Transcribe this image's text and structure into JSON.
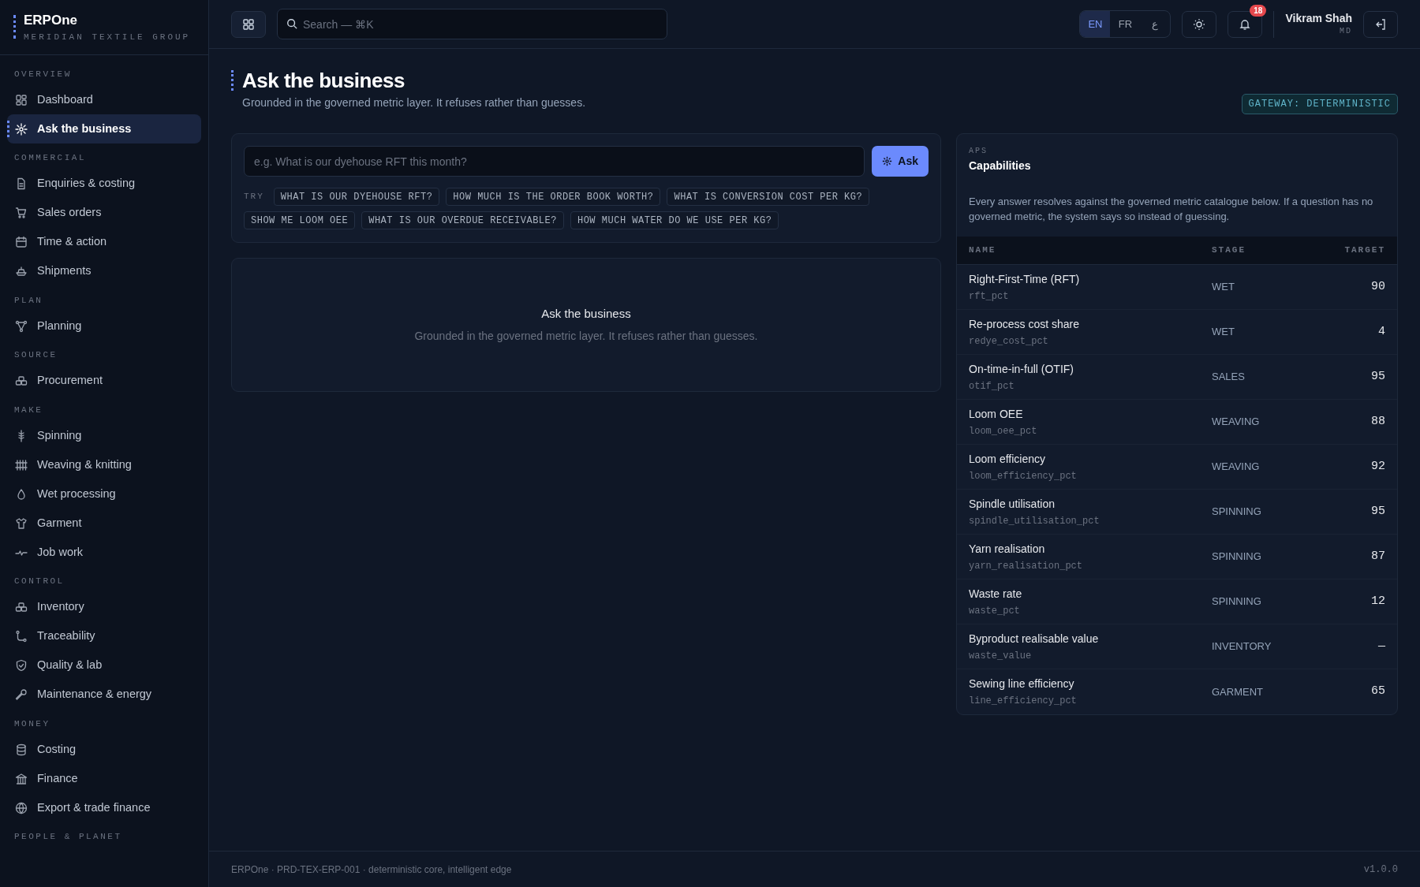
{
  "brand": {
    "name": "ERPOne",
    "subtitle": "MERIDIAN TEXTILE GROUP"
  },
  "sidebar": {
    "sections": [
      {
        "heading": "OVERVIEW",
        "items": [
          {
            "label": "Dashboard",
            "selected": false
          },
          {
            "label": "Ask the business",
            "selected": true
          }
        ]
      },
      {
        "heading": "COMMERCIAL",
        "items": [
          {
            "label": "Enquiries & costing",
            "selected": false
          },
          {
            "label": "Sales orders",
            "selected": false
          },
          {
            "label": "Time & action",
            "selected": false
          },
          {
            "label": "Shipments",
            "selected": false
          }
        ]
      },
      {
        "heading": "PLAN",
        "items": [
          {
            "label": "Planning",
            "selected": false
          }
        ]
      },
      {
        "heading": "SOURCE",
        "items": [
          {
            "label": "Procurement",
            "selected": false
          }
        ]
      },
      {
        "heading": "MAKE",
        "items": [
          {
            "label": "Spinning",
            "selected": false
          },
          {
            "label": "Weaving & knitting",
            "selected": false
          },
          {
            "label": "Wet processing",
            "selected": false
          },
          {
            "label": "Garment",
            "selected": false
          },
          {
            "label": "Job work",
            "selected": false
          }
        ]
      },
      {
        "heading": "CONTROL",
        "items": [
          {
            "label": "Inventory",
            "selected": false
          },
          {
            "label": "Traceability",
            "selected": false
          },
          {
            "label": "Quality & lab",
            "selected": false
          },
          {
            "label": "Maintenance & energy",
            "selected": false
          }
        ]
      },
      {
        "heading": "MONEY",
        "items": [
          {
            "label": "Costing",
            "selected": false
          },
          {
            "label": "Finance",
            "selected": false
          },
          {
            "label": "Export & trade finance",
            "selected": false
          }
        ]
      },
      {
        "heading": "PEOPLE & PLANET"
      }
    ]
  },
  "header": {
    "search": {
      "placeholder": "Search — ⌘K"
    },
    "languages": [
      {
        "label": "EN",
        "selected": true
      },
      {
        "label": "FR",
        "selected": false
      },
      {
        "label": "ع",
        "selected": false
      }
    ],
    "notifications": "18",
    "user": {
      "name": "Vikram Shah",
      "role": "MD"
    }
  },
  "page": {
    "title": "Ask the business",
    "subtitle": "Grounded in the governed metric layer. It refuses rather than guesses.",
    "badge": "GATEWAY: DETERMINISTIC"
  },
  "ask": {
    "placeholder": "e.g. What is our dyehouse RFT this month?",
    "button": "Ask",
    "try_label": "TRY",
    "suggestions": [
      "WHAT IS OUR DYEHOUSE RFT?",
      "HOW MUCH IS THE ORDER BOOK WORTH?",
      "WHAT IS CONVERSION COST PER KG?",
      "SHOW ME LOOM OEE",
      "WHAT IS OUR OVERDUE RECEIVABLE?",
      "HOW MUCH WATER DO WE USE PER KG?"
    ]
  },
  "empty_state": {
    "title": "Ask the business",
    "text": "Grounded in the governed metric layer. It refuses rather than guesses."
  },
  "capabilities": {
    "eyebrow": "APS",
    "title": "Capabilities",
    "description": "Every answer resolves against the governed metric catalogue below. If a question has no governed metric, the system says so instead of guessing.",
    "columns": [
      "NAME",
      "STAGE",
      "TARGET"
    ],
    "rows": [
      {
        "name": "Right-First-Time (RFT)",
        "key": "rft_pct",
        "stage": "WET",
        "target": "90"
      },
      {
        "name": "Re-process cost share",
        "key": "redye_cost_pct",
        "stage": "WET",
        "target": "4"
      },
      {
        "name": "On-time-in-full (OTIF)",
        "key": "otif_pct",
        "stage": "SALES",
        "target": "95"
      },
      {
        "name": "Loom OEE",
        "key": "loom_oee_pct",
        "stage": "WEAVING",
        "target": "88"
      },
      {
        "name": "Loom efficiency",
        "key": "loom_efficiency_pct",
        "stage": "WEAVING",
        "target": "92"
      },
      {
        "name": "Spindle utilisation",
        "key": "spindle_utilisation_pct",
        "stage": "SPINNING",
        "target": "95"
      },
      {
        "name": "Yarn realisation",
        "key": "yarn_realisation_pct",
        "stage": "SPINNING",
        "target": "87"
      },
      {
        "name": "Waste rate",
        "key": "waste_pct",
        "stage": "SPINNING",
        "target": "12"
      },
      {
        "name": "Byproduct realisable value",
        "key": "waste_value",
        "stage": "INVENTORY",
        "target": "—"
      },
      {
        "name": "Sewing line efficiency",
        "key": "line_efficiency_pct",
        "stage": "GARMENT",
        "target": "65"
      }
    ]
  },
  "footer": {
    "text": "ERPOne · PRD-TEX-ERP-001 · deterministic core, intelligent edge",
    "version": "v1.0.0"
  }
}
